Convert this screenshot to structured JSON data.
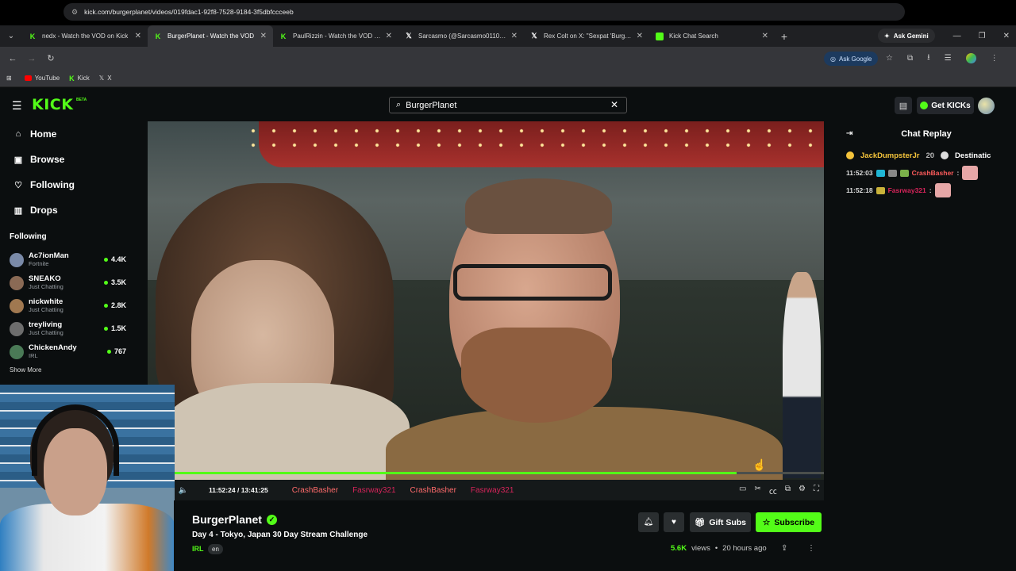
{
  "browser": {
    "tabs": [
      {
        "title": "nedx - Watch the VOD on Kick",
        "icon": "kick-icon",
        "active": false
      },
      {
        "title": "BurgerPlanet - Watch the VOD",
        "icon": "kick-icon",
        "active": true
      },
      {
        "title": "PaulRizzin - Watch the VOD on",
        "icon": "kick-icon",
        "active": false
      },
      {
        "title": "Sarcasmo (@Sarcasmo011011)",
        "icon": "x-icon",
        "active": false
      },
      {
        "title": "Rex Colt on X: \"Sexpat 'BurgerP",
        "icon": "x-icon",
        "active": false
      },
      {
        "title": "Kick Chat Search",
        "icon": "sheet-icon",
        "active": false
      }
    ],
    "gemini_label": "Ask Gemini",
    "url": "kick.com/burgerplanet/videos/019fdac1-92f8-7528-9184-3f5dbfccceeb",
    "ask_google_label": "Ask Google",
    "bookmarks": [
      "YouTube",
      "Kick",
      "X"
    ]
  },
  "header": {
    "logo_text": "KICK",
    "beta_text": "BETA",
    "search_value": "BurgerPlanet",
    "get_kicks_label": "Get KICKs"
  },
  "sidebar": {
    "nav": [
      {
        "label": "Home",
        "icon": "home-icon"
      },
      {
        "label": "Browse",
        "icon": "browse-icon"
      },
      {
        "label": "Following",
        "icon": "heart-icon"
      },
      {
        "label": "Drops",
        "icon": "drops-icon"
      }
    ],
    "following_title": "Following",
    "channels": [
      {
        "name": "Ac7ionMan",
        "category": "Fortnite",
        "viewers": "4.4K",
        "color": "#7a8aa8"
      },
      {
        "name": "SNEAKO",
        "category": "Just Chatting",
        "viewers": "3.5K",
        "color": "#8a6a55"
      },
      {
        "name": "nickwhite",
        "category": "Just Chatting",
        "viewers": "2.8K",
        "color": "#a07850"
      },
      {
        "name": "treyliving",
        "category": "Just Chatting",
        "viewers": "1.5K",
        "color": "#6d6d6d"
      },
      {
        "name": "ChickenAndy",
        "category": "IRL",
        "viewers": "767",
        "color": "#4a7a56"
      }
    ],
    "show_more": "Show More"
  },
  "player": {
    "time_current": "11:52:24",
    "time_separator": "/",
    "time_total": "13:41:25",
    "progress": 0.866,
    "ticker": [
      {
        "name": "CrashBasher",
        "style": "cb"
      },
      {
        "name": "Fasrway321",
        "style": "fs"
      },
      {
        "name": "CrashBasher",
        "style": "cb"
      },
      {
        "name": "Fasrway321",
        "style": "fs"
      }
    ]
  },
  "stream": {
    "name": "BurgerPlanet",
    "title": "Day 4 - Tokyo, Japan 30 Day Stream Challenge",
    "category": "IRL",
    "language": "en",
    "gift_subs_label": "Gift Subs",
    "subscribe_label": "Subscribe",
    "views": "5.6K",
    "views_label": "views",
    "dot": "•",
    "age": "20 hours ago"
  },
  "chat": {
    "title": "Chat Replay",
    "pinned": {
      "user1": "JackDumpsterJr",
      "count": "20",
      "user2": "Destinatic"
    },
    "messages": [
      {
        "time": "11:52:03",
        "user": "CrashBasher",
        "style": "u1"
      },
      {
        "time": "11:52:18",
        "user": "Fasrway321",
        "style": "u2"
      }
    ]
  },
  "colors": {
    "accent": "#53fc18",
    "background": "#0b0e0f"
  }
}
